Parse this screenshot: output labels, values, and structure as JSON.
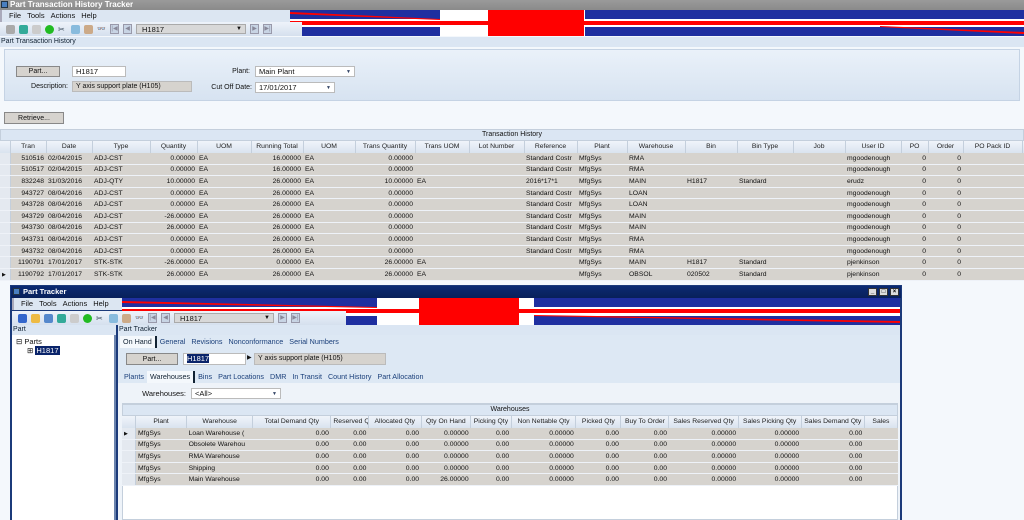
{
  "top_window": {
    "title": "Part Transaction History Tracker",
    "menu": [
      "File",
      "Tools",
      "Actions",
      "Help"
    ],
    "toolbar_part": "H1817",
    "section_title": "Part Transaction History",
    "part_button": "Part...",
    "part_value": "H1817",
    "description_label": "Description:",
    "description_value": "Y axis support plate (H105)",
    "plant_label": "Plant:",
    "plant_value": "Main Plant",
    "cutoff_label": "Cut Off Date:",
    "cutoff_value": "17/01/2017",
    "retrieve_button": "Retrieve...",
    "grid_title": "Transaction History",
    "columns": [
      "Tran",
      "Date",
      "Type",
      "Quantity",
      "UOM",
      "Running Total",
      "UOM",
      "Trans Quantity",
      "Trans UOM",
      "Lot Number",
      "Reference",
      "Plant",
      "Warehouse",
      "Bin",
      "Bin Type",
      "Job",
      "User ID",
      "PO",
      "Order",
      "PO Pack ID"
    ],
    "rows": [
      [
        "510516",
        "02/04/2015",
        "ADJ-CST",
        "0.00000",
        "EA",
        "16.00000",
        "EA",
        "0.00000",
        "",
        "",
        "Standard Costr",
        "MfgSys",
        "RMA",
        "",
        "",
        "",
        "mgoodenough",
        "0",
        "0",
        ""
      ],
      [
        "510517",
        "02/04/2015",
        "ADJ-CST",
        "0.00000",
        "EA",
        "16.00000",
        "EA",
        "0.00000",
        "",
        "",
        "Standard Costr",
        "MfgSys",
        "RMA",
        "",
        "",
        "",
        "mgoodenough",
        "0",
        "0",
        ""
      ],
      [
        "832248",
        "31/03/2016",
        "ADJ-QTY",
        "10.00000",
        "EA",
        "26.00000",
        "EA",
        "10.00000",
        "EA",
        "",
        "2016*17*1",
        "MfgSys",
        "MAIN",
        "H1817",
        "Standard",
        "",
        "erudz",
        "0",
        "0",
        ""
      ],
      [
        "943727",
        "08/04/2016",
        "ADJ-CST",
        "0.00000",
        "EA",
        "26.00000",
        "EA",
        "0.00000",
        "",
        "",
        "Standard Costr",
        "MfgSys",
        "LOAN",
        "",
        "",
        "",
        "mgoodenough",
        "0",
        "0",
        ""
      ],
      [
        "943728",
        "08/04/2016",
        "ADJ-CST",
        "0.00000",
        "EA",
        "26.00000",
        "EA",
        "0.00000",
        "",
        "",
        "Standard Costr",
        "MfgSys",
        "LOAN",
        "",
        "",
        "",
        "mgoodenough",
        "0",
        "0",
        ""
      ],
      [
        "943729",
        "08/04/2016",
        "ADJ-CST",
        "-26.00000",
        "EA",
        "26.00000",
        "EA",
        "0.00000",
        "",
        "",
        "Standard Costr",
        "MfgSys",
        "MAIN",
        "",
        "",
        "",
        "mgoodenough",
        "0",
        "0",
        ""
      ],
      [
        "943730",
        "08/04/2016",
        "ADJ-CST",
        "26.00000",
        "EA",
        "26.00000",
        "EA",
        "0.00000",
        "",
        "",
        "Standard Costr",
        "MfgSys",
        "MAIN",
        "",
        "",
        "",
        "mgoodenough",
        "0",
        "0",
        ""
      ],
      [
        "943731",
        "08/04/2016",
        "ADJ-CST",
        "0.00000",
        "EA",
        "26.00000",
        "EA",
        "0.00000",
        "",
        "",
        "Standard Costr",
        "MfgSys",
        "RMA",
        "",
        "",
        "",
        "mgoodenough",
        "0",
        "0",
        ""
      ],
      [
        "943732",
        "08/04/2016",
        "ADJ-CST",
        "0.00000",
        "EA",
        "26.00000",
        "EA",
        "0.00000",
        "",
        "",
        "Standard Costr",
        "MfgSys",
        "RMA",
        "",
        "",
        "",
        "mgoodenough",
        "0",
        "0",
        ""
      ],
      [
        "1190791",
        "17/01/2017",
        "STK-STK",
        "-26.00000",
        "EA",
        "0.00000",
        "EA",
        "26.00000",
        "EA",
        "",
        "",
        "MfgSys",
        "MAIN",
        "H1817",
        "Standard",
        "",
        "pjenkinson",
        "0",
        "0",
        ""
      ],
      [
        "1190792",
        "17/01/2017",
        "STK-STK",
        "26.00000",
        "EA",
        "26.00000",
        "EA",
        "26.00000",
        "EA",
        "",
        "",
        "MfgSys",
        "OBSOL",
        "020502",
        "Standard",
        "",
        "pjenkinson",
        "0",
        "0",
        ""
      ]
    ],
    "current_row": 10
  },
  "bottom_window": {
    "title": "Part Tracker",
    "menu": [
      "File",
      "Tools",
      "Actions",
      "Help"
    ],
    "toolbar_part": "H1817",
    "tree_header": "Part",
    "tree_root": "Parts",
    "tree_node": "H1817",
    "panel_title": "Part Tracker",
    "tabs": [
      "On Hand",
      "General",
      "Revisions",
      "Nonconformance",
      "Serial Numbers"
    ],
    "part_button": "Part...",
    "part_value": "H1817",
    "description_value": "Y axis support plate (H105)",
    "subtabs": [
      "Plants",
      "Warehouses",
      "Bins",
      "Part Locations",
      "DMR",
      "In Transit",
      "Count History",
      "Part Allocation"
    ],
    "warehouses_label": "Warehouses:",
    "warehouses_value": "<All>",
    "grid_title": "Warehouses",
    "columns": [
      "Plant",
      "Warehouse",
      "Total Demand Qty",
      "Reserved Qty",
      "Allocated Qty",
      "Qty On Hand",
      "Picking Qty",
      "Non Nettable Qty",
      "Picked Qty",
      "Buy To Order",
      "Sales Reserved Qty",
      "Sales Picking Qty",
      "Sales Demand Qty",
      "Sales"
    ],
    "rows": [
      [
        "MfgSys",
        "Loan Warehouse (",
        "0.00",
        "0.00",
        "0.00",
        "0.00000",
        "0.00",
        "0.00000",
        "0.00",
        "0.00",
        "0.00000",
        "0.00000",
        "0.00",
        ""
      ],
      [
        "MfgSys",
        "Obsolete Warehou",
        "0.00",
        "0.00",
        "0.00",
        "0.00000",
        "0.00",
        "0.00000",
        "0.00",
        "0.00",
        "0.00000",
        "0.00000",
        "0.00",
        ""
      ],
      [
        "MfgSys",
        "RMA Warehouse",
        "0.00",
        "0.00",
        "0.00",
        "0.00000",
        "0.00",
        "0.00000",
        "0.00",
        "0.00",
        "0.00000",
        "0.00000",
        "0.00",
        ""
      ],
      [
        "MfgSys",
        "Shipping",
        "0.00",
        "0.00",
        "0.00",
        "0.00000",
        "0.00",
        "0.00000",
        "0.00",
        "0.00",
        "0.00000",
        "0.00000",
        "0.00",
        ""
      ],
      [
        "MfgSys",
        "Main Warehouse",
        "0.00",
        "0.00",
        "0.00",
        "26.00000",
        "0.00",
        "0.00000",
        "0.00",
        "0.00",
        "0.00000",
        "0.00000",
        "0.00",
        ""
      ]
    ],
    "current_row": 0
  },
  "colors": {
    "title_active": "#0b2a72",
    "grid_cell": "#d6d3ce",
    "flag_red": "#ff0000",
    "flag_blue": "#1f2fa0"
  }
}
